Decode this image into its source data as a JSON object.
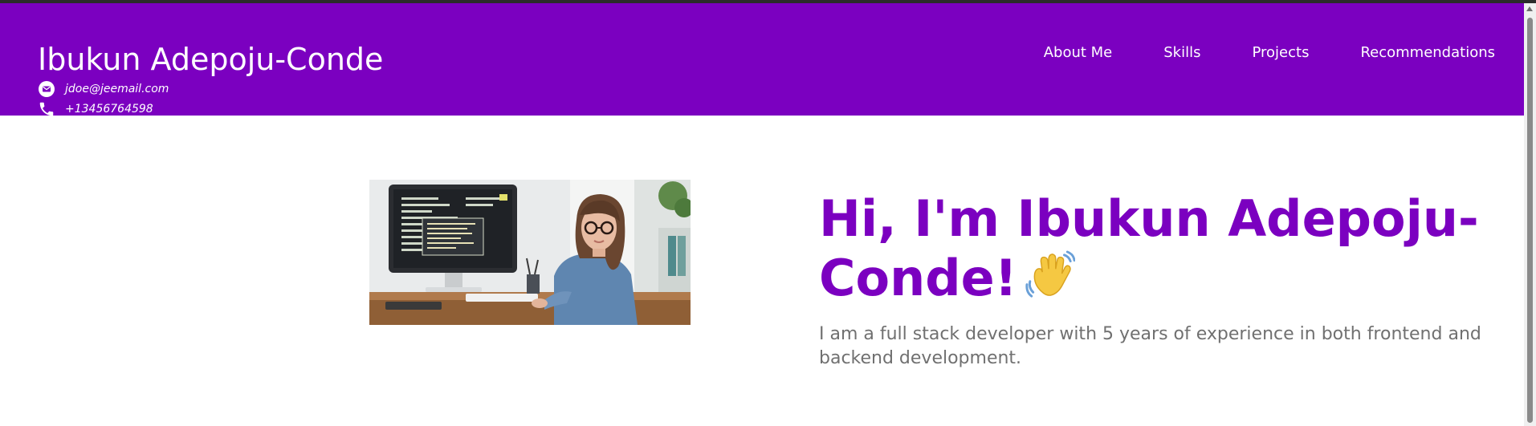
{
  "header": {
    "name": "Ibukun Adepoju-Conde",
    "email": "jdoe@jeemail.com",
    "phone": "+13456764598",
    "nav": [
      "About Me",
      "Skills",
      "Projects",
      "Recommendations"
    ]
  },
  "hero": {
    "title": "Hi, I'm Ibukun Adepoju-Conde!",
    "description": "I am a full stack developer with 5 years of experience in both frontend and backend development.",
    "image_icon": "developer-photo"
  },
  "colors": {
    "brand": "#7b00c0",
    "text_muted": "#707070",
    "background": "#ffffff"
  }
}
